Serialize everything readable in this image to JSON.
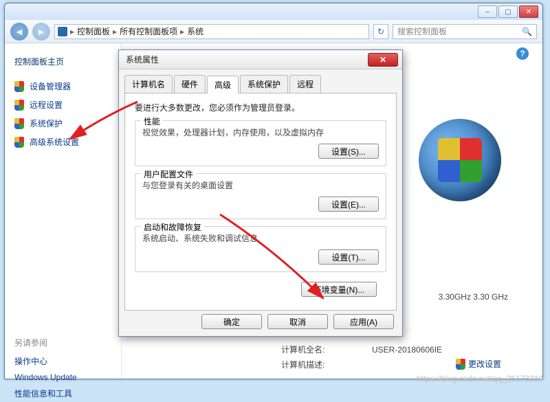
{
  "window": {
    "min": "–",
    "max": "▢",
    "close": "✕"
  },
  "breadcrumb": {
    "parts": [
      "控制面板",
      "所有控制面板项",
      "系统"
    ],
    "sep": "▸"
  },
  "search": {
    "placeholder": "搜索控制面板"
  },
  "sidebar": {
    "title": "控制面板主页",
    "items": [
      {
        "label": "设备管理器"
      },
      {
        "label": "远程设置"
      },
      {
        "label": "系统保护"
      },
      {
        "label": "高级系统设置"
      }
    ],
    "seealso_title": "另请参阅",
    "seealso": [
      {
        "label": "操作中心"
      },
      {
        "label": "Windows Update"
      },
      {
        "label": "性能信息和工具"
      }
    ]
  },
  "content": {
    "cpu": "3.30GHz   3.30 GHz",
    "change_settings_icon": "🛡",
    "change_settings": "更改设置",
    "rows": {
      "fullname_label": "计算机全名:",
      "fullname_value": "USER-20180606IE",
      "desc_label": "计算机描述:"
    }
  },
  "dialog": {
    "title": "系统属性",
    "close": "✕",
    "tabs": [
      "计算机名",
      "硬件",
      "高级",
      "系统保护",
      "远程"
    ],
    "active_tab": 2,
    "intro": "要进行大多数更改，您必须作为管理员登录。",
    "groups": {
      "perf": {
        "legend": "性能",
        "desc": "视觉效果，处理器计划，内存使用，以及虚拟内存",
        "btn": "设置(S)..."
      },
      "profiles": {
        "legend": "用户配置文件",
        "desc": "与您登录有关的桌面设置",
        "btn": "设置(E)..."
      },
      "startup": {
        "legend": "启动和故障恢复",
        "desc": "系统启动、系统失败和调试信息",
        "btn": "设置(T)..."
      }
    },
    "env_btn": "环境变量(N)...",
    "footer": {
      "ok": "确定",
      "cancel": "取消",
      "apply": "应用(A)"
    }
  },
  "watermark": "https://blog.csdn.net/qq_26173219"
}
